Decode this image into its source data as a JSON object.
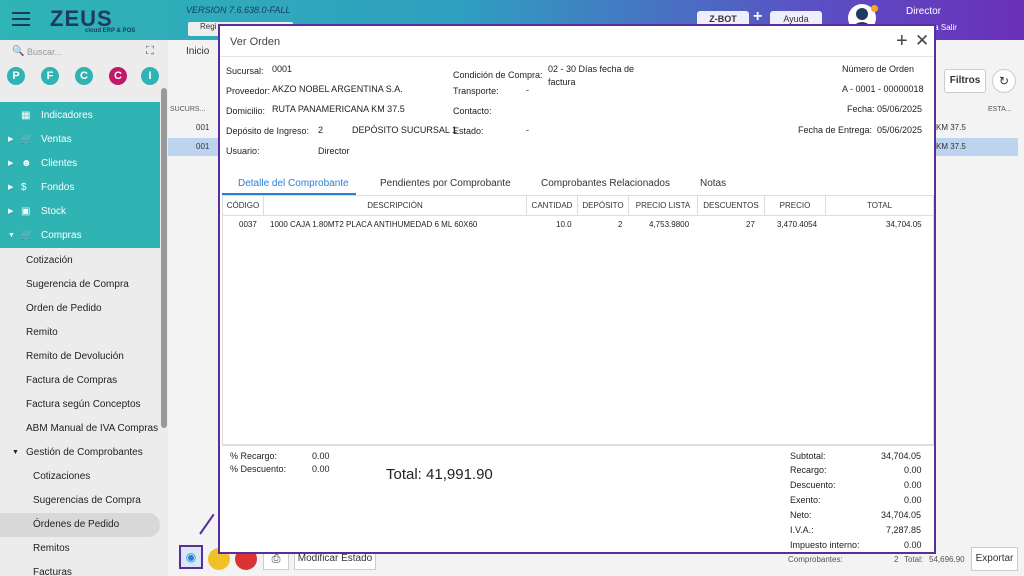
{
  "topbar": {
    "logo": "ZEUS",
    "logo_sub": "cloud ERP & POS",
    "version": "VERSION 7.6.638.0-FALL",
    "reg_label": "Regi",
    "zbot_label": "Z-BOT",
    "plus_label": "+",
    "ayuda_label": "Ayuda",
    "user_name": "Director",
    "user_links": "ta   Salir"
  },
  "sidebar": {
    "search_placeholder": "Buscar...",
    "circles": [
      {
        "letter": "P",
        "color": "#2fb3b3"
      },
      {
        "letter": "F",
        "color": "#2fb3b3"
      },
      {
        "letter": "C",
        "color": "#2fb3b3"
      },
      {
        "letter": "C",
        "color": "#c2186b"
      },
      {
        "letter": "I",
        "color": "#2fb3b3"
      }
    ],
    "menu": [
      {
        "label": "Indicadores",
        "icon": "chart-icon"
      },
      {
        "label": "Ventas",
        "icon": "cart-icon"
      },
      {
        "label": "Clientes",
        "icon": "people-icon"
      },
      {
        "label": "Fondos",
        "icon": "dollar-icon"
      },
      {
        "label": "Stock",
        "icon": "box-icon"
      },
      {
        "label": "Compras",
        "icon": "cart-icon"
      }
    ],
    "sub": [
      "Cotización",
      "Sugerencia de Compra",
      "Orden de Pedido",
      "Remito",
      "Remito de Devolución",
      "Factura de Compras",
      "Factura según Conceptos",
      "ABM Manual de IVA Compras",
      "Gestión de Comprobantes"
    ],
    "sub2": [
      "Cotizaciones",
      "Sugerencias de Compra",
      "Órdenes de Pedido",
      "Remitos",
      "Facturas"
    ]
  },
  "main": {
    "breadcrumb": "Inicio",
    "filtros": "Filtros",
    "col_sucursal": "SUCURS...",
    "col_esta": "ESTA...",
    "rows": [
      {
        "suc": "001",
        "right": "KM 37.5"
      },
      {
        "suc": "001",
        "right": "KM 37.5"
      }
    ],
    "modificar": "Modificar Estado",
    "comprobantes": "Comprobantes:",
    "comprobantes_count": "2",
    "total_label": "Total:",
    "total_value": "54,696.90",
    "exportar": "Exportar"
  },
  "modal": {
    "title": "Ver Orden",
    "sucursal_label": "Sucursal:",
    "sucursal": "0001",
    "proveedor_label": "Proveedor:",
    "proveedor": "AKZO NOBEL ARGENTINA S.A.",
    "domicilio_label": "Domicilio:",
    "domicilio": "RUTA PANAMERICANA KM 37.5",
    "deposito_label": "Depósito de Ingreso:",
    "deposito_num": "2",
    "deposito_name": "DEPÓSITO SUCURSAL 1",
    "usuario_label": "Usuario:",
    "usuario": "Director",
    "condicion_label": "Condición de Compra:",
    "condicion_1": "02 - 30 Días fecha de",
    "condicion_2": "factura",
    "transporte_label": "Transporte:",
    "transporte": "-",
    "contacto_label": "Contacto:",
    "estado_label": "Estado:",
    "estado": "-",
    "numero_label": "Número de Orden",
    "numero": "A - 0001 - 00000018",
    "fecha_label": "Fecha:",
    "fecha": "05/06/2025",
    "entrega_label": "Fecha de Entrega:",
    "entrega": "05/06/2025",
    "tabs": [
      "Detalle del Comprobante",
      "Pendientes por Comprobante",
      "Comprobantes Relacionados",
      "Notas"
    ],
    "columns": [
      "CÓDIGO",
      "DESCRIPCIÓN",
      "CANTIDAD",
      "DEPÓSITO",
      "PRECIO LISTA",
      "DESCUENTOS",
      "PRECIO",
      "TOTAL"
    ],
    "items": [
      {
        "codigo": "0037",
        "descripcion": "1000 CAJA 1.80MT2 PLACA ANTIHUMEDAD 6 ML 60X60",
        "cantidad": "10.0",
        "deposito": "2",
        "precio_lista": "4,753.9800",
        "descuentos": "27",
        "precio": "3,470.4054",
        "total": "34,704.05"
      }
    ],
    "recargo_label": "% Recargo:",
    "recargo": "0.00",
    "descuento_pct_label": "% Descuento:",
    "descuento_pct": "0.00",
    "total_label": "Total:",
    "total": "41,991.90",
    "summary": [
      {
        "label": "Subtotal:",
        "value": "34,704.05"
      },
      {
        "label": "Recargo:",
        "value": "0.00"
      },
      {
        "label": "Descuento:",
        "value": "0.00"
      },
      {
        "label": "Exento:",
        "value": "0.00"
      },
      {
        "label": "Neto:",
        "value": "34,704.05"
      },
      {
        "label": "I.V.A.:",
        "value": "7,287.85"
      },
      {
        "label": "Impuesto interno:",
        "value": "0.00"
      }
    ]
  }
}
